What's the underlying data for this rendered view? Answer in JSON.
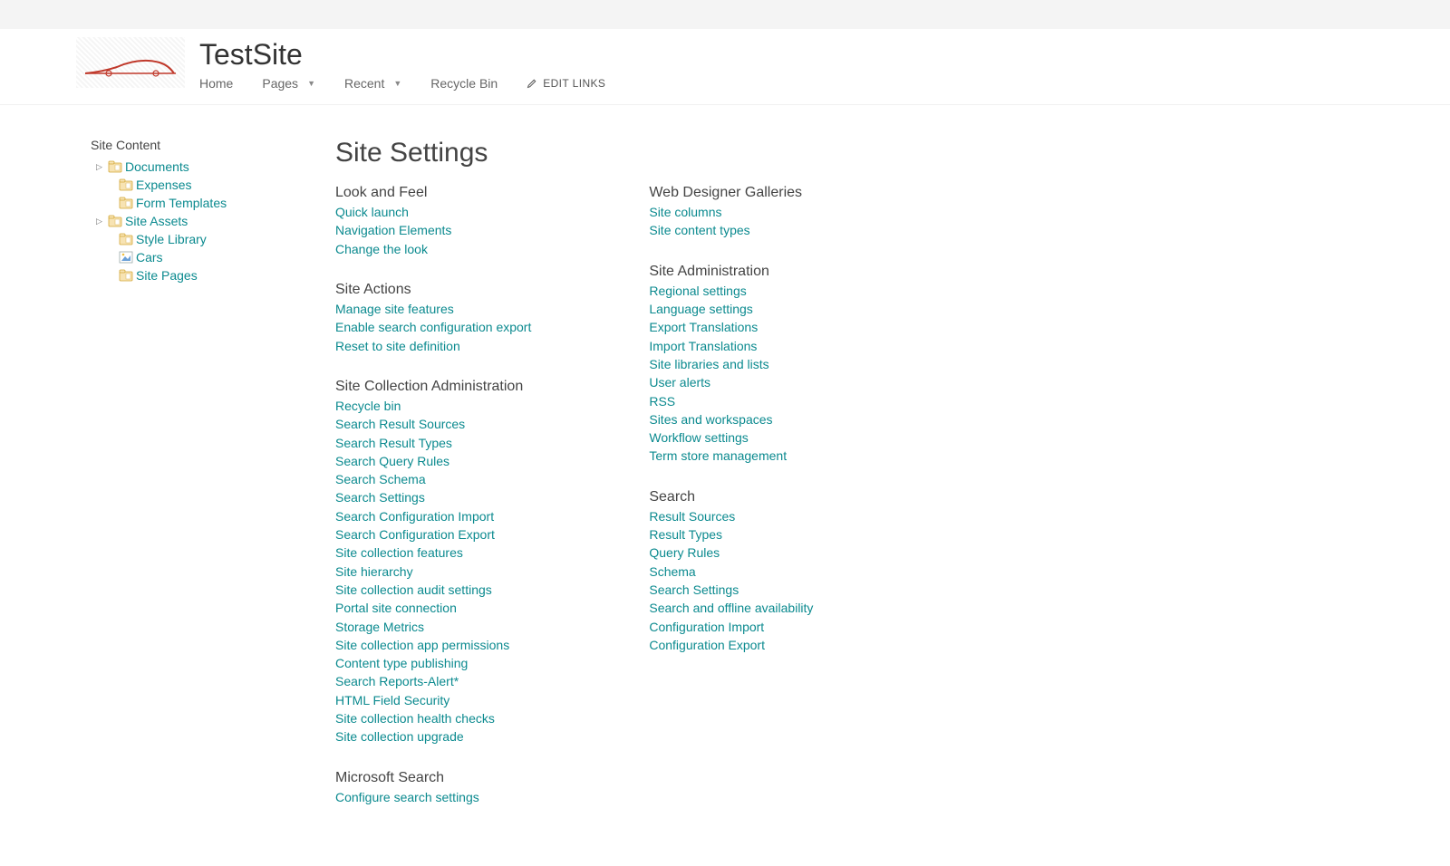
{
  "site": {
    "title": "TestSite"
  },
  "topnav": {
    "items": [
      {
        "label": "Home",
        "hasDropdown": false
      },
      {
        "label": "Pages",
        "hasDropdown": true
      },
      {
        "label": "Recent",
        "hasDropdown": true
      },
      {
        "label": "Recycle Bin",
        "hasDropdown": false
      }
    ],
    "editLinks": "EDIT LINKS"
  },
  "leftnav": {
    "header": "Site Content",
    "items": [
      {
        "label": "Documents",
        "expandable": true,
        "indent": 1,
        "icon": "folder"
      },
      {
        "label": "Expenses",
        "expandable": false,
        "indent": 2,
        "icon": "folder"
      },
      {
        "label": "Form Templates",
        "expandable": false,
        "indent": 2,
        "icon": "folder"
      },
      {
        "label": "Site Assets",
        "expandable": true,
        "indent": 1,
        "icon": "folder"
      },
      {
        "label": "Style Library",
        "expandable": false,
        "indent": 2,
        "icon": "folder"
      },
      {
        "label": "Cars",
        "expandable": false,
        "indent": 2,
        "icon": "image"
      },
      {
        "label": "Site Pages",
        "expandable": false,
        "indent": 2,
        "icon": "folder"
      }
    ]
  },
  "page": {
    "title": "Site Settings"
  },
  "columns": [
    {
      "groups": [
        {
          "heading": "Look and Feel",
          "links": [
            "Quick launch",
            "Navigation Elements",
            "Change the look"
          ]
        },
        {
          "heading": "Site Actions",
          "links": [
            "Manage site features",
            "Enable search configuration export",
            "Reset to site definition"
          ]
        },
        {
          "heading": "Site Collection Administration",
          "links": [
            "Recycle bin",
            "Search Result Sources",
            "Search Result Types",
            "Search Query Rules",
            "Search Schema",
            "Search Settings",
            "Search Configuration Import",
            "Search Configuration Export",
            "Site collection features",
            "Site hierarchy",
            "Site collection audit settings",
            "Portal site connection",
            "Storage Metrics",
            "Site collection app permissions",
            "Content type publishing",
            "Search Reports-Alert*",
            "HTML Field Security",
            "Site collection health checks",
            "Site collection upgrade"
          ]
        },
        {
          "heading": "Microsoft Search",
          "links": [
            "Configure search settings"
          ]
        }
      ]
    },
    {
      "groups": [
        {
          "heading": "Web Designer Galleries",
          "links": [
            "Site columns",
            "Site content types"
          ]
        },
        {
          "heading": "Site Administration",
          "links": [
            "Regional settings",
            "Language settings",
            "Export Translations",
            "Import Translations",
            "Site libraries and lists",
            "User alerts",
            "RSS",
            "Sites and workspaces",
            "Workflow settings",
            "Term store management"
          ]
        },
        {
          "heading": "Search",
          "links": [
            "Result Sources",
            "Result Types",
            "Query Rules",
            "Schema",
            "Search Settings",
            "Search and offline availability",
            "Configuration Import",
            "Configuration Export"
          ]
        }
      ]
    }
  ]
}
